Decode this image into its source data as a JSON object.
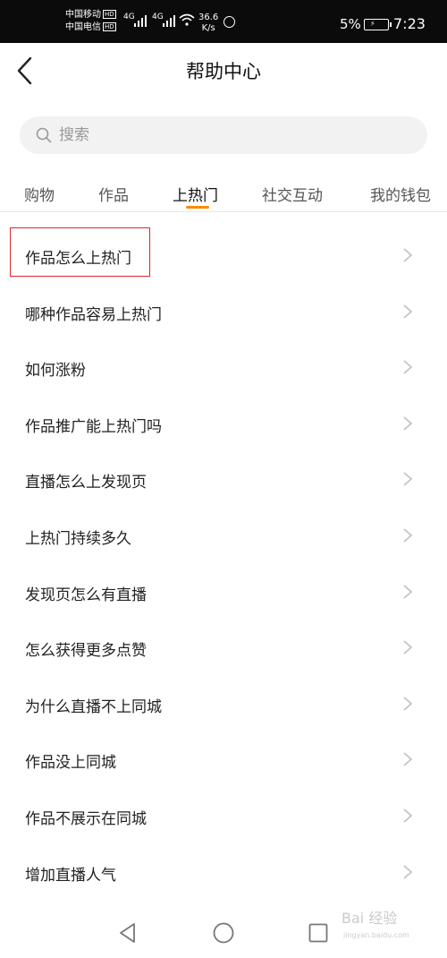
{
  "status_bar": {
    "carrier_1": "中国移动",
    "carrier_2": "中国电信",
    "hd_badge": "HD",
    "network_type": "4G",
    "speed_value": "36.6",
    "speed_unit": "K/s",
    "battery_percent": "5%",
    "time": "7:23"
  },
  "header": {
    "title": "帮助中心",
    "back_icon": "chevron-left-icon"
  },
  "search": {
    "placeholder": "搜索",
    "icon": "search-icon"
  },
  "tabs": [
    {
      "label": "购物",
      "active": false
    },
    {
      "label": "作品",
      "active": false
    },
    {
      "label": "上热门",
      "active": true
    },
    {
      "label": "社交互动",
      "active": false
    },
    {
      "label": "我的钱包",
      "active": false
    }
  ],
  "accent_color": "#ff8a00",
  "highlight_color": "#e0262c",
  "faq_items": [
    "作品怎么上热门",
    "哪种作品容易上热门",
    "如何涨粉",
    "作品推广能上热门吗",
    "直播怎么上发现页",
    "上热门持续多久",
    "发现页怎么有直播",
    "怎么获得更多点赞",
    "为什么直播不上同城",
    "作品没上同城",
    "作品不展示在同城",
    "增加直播人气"
  ],
  "nav_bar": {
    "back_icon": "triangle-back-icon",
    "home_icon": "circle-home-icon",
    "recents_icon": "square-recents-icon"
  },
  "watermark": {
    "text": "Bai 经验",
    "sub": "jingyan.baidu.com"
  }
}
